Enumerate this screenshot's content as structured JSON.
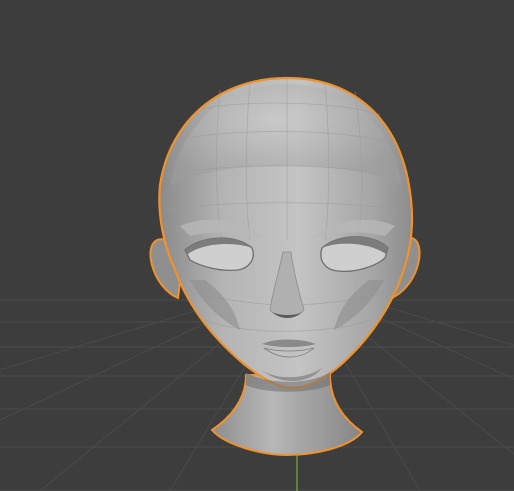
{
  "viewport": {
    "background_color": "#3d3d3d",
    "grid_color": "#4a4a4a",
    "y_axis_color": "#6f9a3b",
    "selection_outline_color": "#f0922b",
    "mesh_base_color": "#a7a7a7",
    "mesh_light_color": "#c8c8c8",
    "mesh_dark_color": "#7a7a7a",
    "object": "head-mesh"
  }
}
